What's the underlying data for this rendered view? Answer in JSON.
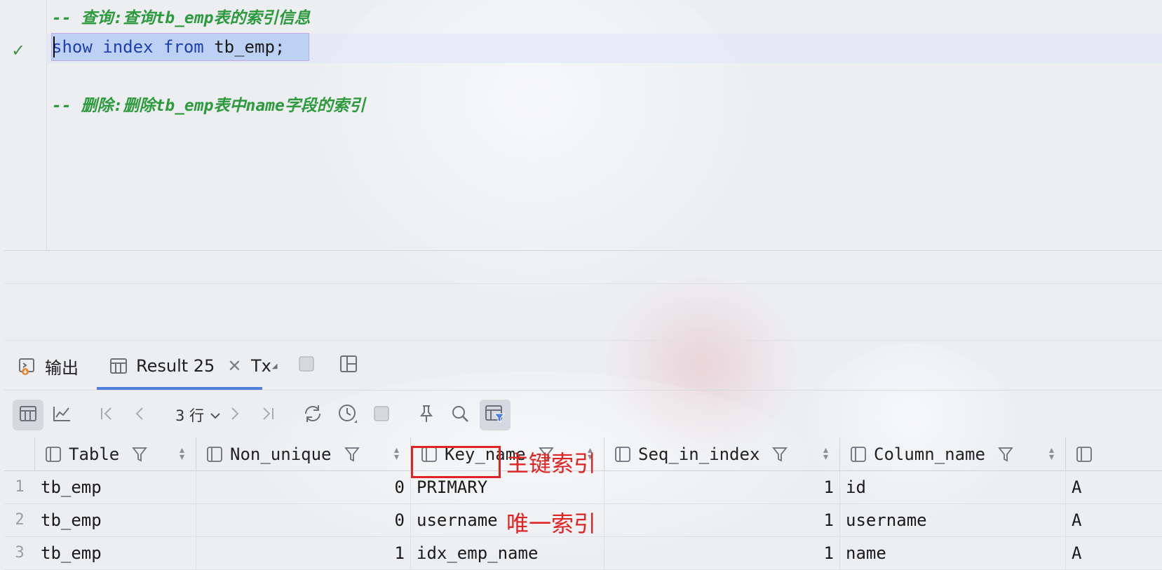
{
  "editor": {
    "comment1": "-- 查询:查询tb_emp表的索引信息",
    "statement": {
      "kw1": "show",
      "kw2": "index",
      "kw3": "from",
      "table": "tb_emp",
      "end": ";"
    },
    "comment2": "-- 删除:删除tb_emp表中name字段的索引"
  },
  "tabs": [
    {
      "label": "输出",
      "icon": "console-output-icon"
    },
    {
      "label": "Result 25",
      "icon": "table-grid-icon",
      "closable": true,
      "active": true
    },
    {
      "label": "Tx",
      "icon": "transaction-icon"
    }
  ],
  "toolbar": {
    "rows_label": "3 行",
    "items": [
      "grid-view-icon",
      "chart-view-icon",
      "first-page-icon",
      "prev-page-icon",
      "next-page-icon",
      "last-page-icon",
      "refresh-icon",
      "history-icon",
      "stop-icon",
      "pin-icon",
      "search-icon",
      "filter-panel-icon"
    ]
  },
  "grid": {
    "columns": [
      "Table",
      "Non_unique",
      "Key_name",
      "Seq_in_index",
      "Column_name"
    ],
    "rows": [
      {
        "n": "1",
        "table": "tb_emp",
        "non_unique": "0",
        "key_name": "PRIMARY",
        "seq": "1",
        "column_name": "id",
        "next": "A"
      },
      {
        "n": "2",
        "table": "tb_emp",
        "non_unique": "0",
        "key_name": "username",
        "seq": "1",
        "column_name": "username",
        "next": "A"
      },
      {
        "n": "3",
        "table": "tb_emp",
        "non_unique": "1",
        "key_name": "idx_emp_name",
        "seq": "1",
        "column_name": "name",
        "next": "A"
      }
    ]
  },
  "annotations": {
    "primary": "主键索引",
    "unique": "唯一索引"
  },
  "colors": {
    "keyword": "#1e3fb0",
    "comment": "#2d9a3d",
    "annotation": "#e02424",
    "tab_active": "#4f7ddb"
  }
}
